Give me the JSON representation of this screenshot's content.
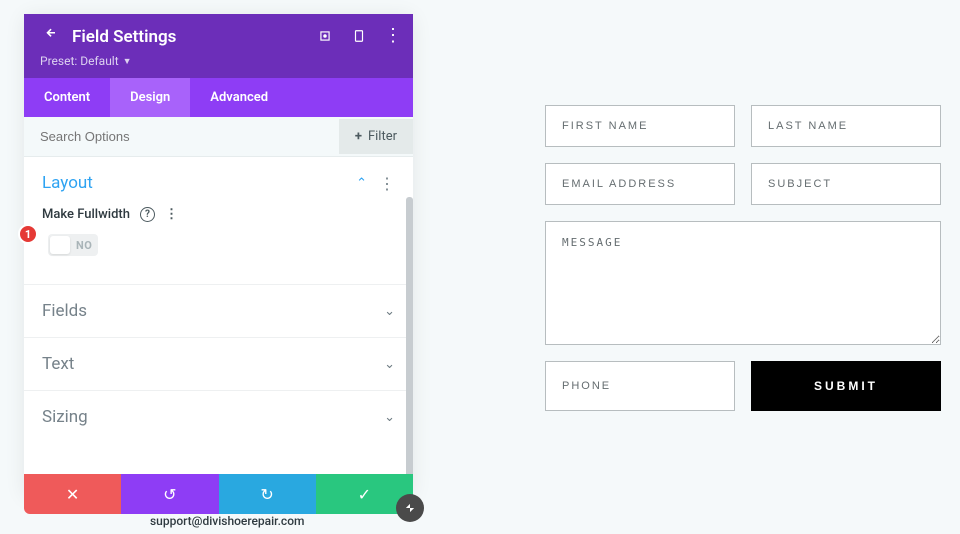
{
  "panel": {
    "title": "Field Settings",
    "preset_label": "Preset: Default"
  },
  "tabs": {
    "content": "Content",
    "design": "Design",
    "advanced": "Advanced"
  },
  "search": {
    "placeholder": "Search Options",
    "filter_label": "Filter"
  },
  "sections": {
    "layout": "Layout",
    "fields": "Fields",
    "text": "Text",
    "sizing": "Sizing"
  },
  "layout_opts": {
    "make_fullwidth_label": "Make Fullwidth",
    "toggle_state": "NO"
  },
  "callout": {
    "num": "1"
  },
  "footer_email": "support@divishoerepair.com",
  "form": {
    "first_name": "FIRST NAME",
    "last_name": "LAST NAME",
    "email": "EMAIL ADDRESS",
    "subject": "SUBJECT",
    "message": "MESSAGE",
    "phone": "PHONE",
    "submit": "SUBMIT"
  }
}
